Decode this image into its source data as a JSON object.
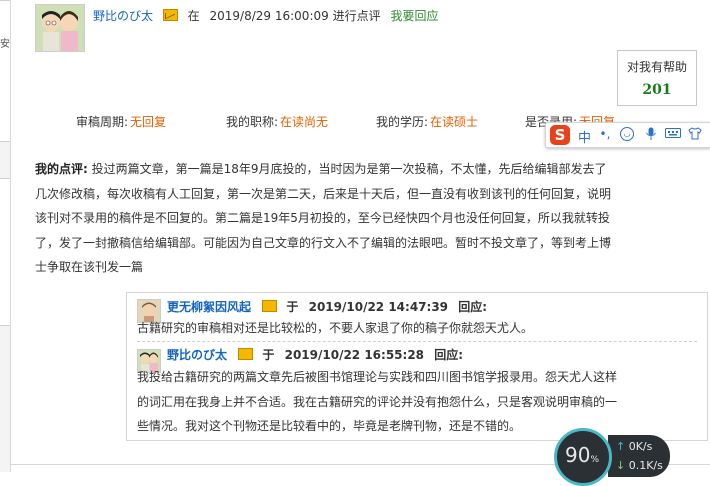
{
  "left_edge_char": "安",
  "header": {
    "username": "野比のび太",
    "preposition": "在",
    "datetime": "2019/8/29 16:00:09",
    "action": "进行点评",
    "reply_link": "我要回应"
  },
  "helpful": {
    "label": "对我有帮助",
    "count": "201"
  },
  "meta": [
    {
      "label": "审稿周期:",
      "value": "无回复"
    },
    {
      "label": "我的职称:",
      "value": "在读尚无"
    },
    {
      "label": "我的学历:",
      "value": "在读硕士"
    },
    {
      "label": "是否录用:",
      "value": "无回复"
    }
  ],
  "ime_toolbar": {
    "logo": "S",
    "mode": "中",
    "icons": [
      "dot-punct-icon",
      "smile-icon",
      "mic-icon",
      "keyboard-icon",
      "shirt-icon",
      "grid-icon"
    ]
  },
  "review": {
    "lead": "我的点评:",
    "text": "投过两篇文章，第一篇是18年9月底投的，当时因为是第一次投稿，不太懂，先后给编辑部发去了几次修改稿，每次收稿有人工回复，第一次是第二天，后来是十天后，但一直没有收到该刊的任何回复，说明该刊对不录用的稿件是不回复的。第二篇是19年5月初投的，至今已经快四个月也没任何回复，所以我就转投了，发了一封撤稿信给编辑部。可能因为自己文章的行文入不了编辑的法眼吧。暂时不投文章了，等到考上博士争取在该刊发一篇"
  },
  "replies": [
    {
      "username": "更无柳絮因风起",
      "preposition": "于",
      "datetime": "2019/10/22 14:47:39",
      "label": "回应:",
      "text": "古籍研究的审稿相对还是比较松的，不要人家退了你的稿子你就怨天尤人。"
    },
    {
      "username": "野比のび太",
      "preposition": "于",
      "datetime": "2019/10/22 16:55:28",
      "label": "回应:",
      "lines": [
        "我投给古籍研究的两篇文章先后被图书馆理论与实践和四川图书馆学报录用。怨天尤人这样",
        "的词汇用在我身上并不合适。我在古籍研究的评论并没有抱怨什么，只是客观说明审稿的一",
        "些情况。我对这个刊物还是比较看中的，毕竟是老牌刊物，还是不错的。"
      ]
    }
  ],
  "net_widget": {
    "percent": "90",
    "percent_unit": "%",
    "up": "0K/s",
    "down": "0.1K/s"
  }
}
